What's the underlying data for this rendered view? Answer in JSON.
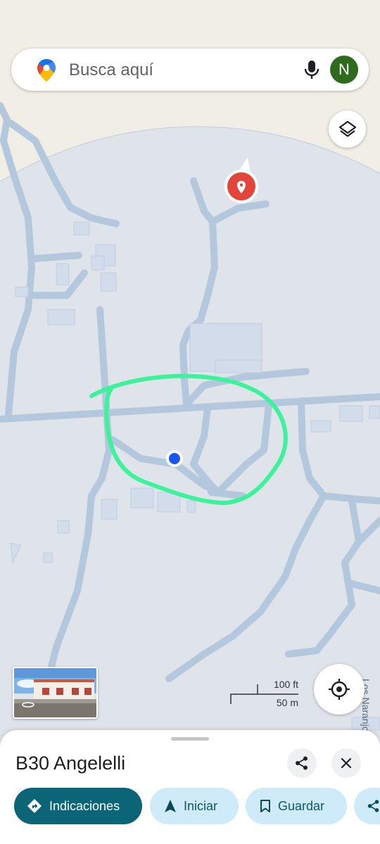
{
  "search": {
    "placeholder": "Busca aquí"
  },
  "account": {
    "initial": "N",
    "color": "#2f6b1f"
  },
  "map": {
    "scale_labels": {
      "feet": "100 ft",
      "meters": "50 m"
    },
    "street_label": "Los Naranjos",
    "colors": {
      "land": "#f1eee6",
      "area": "#dfe3ea",
      "road": "#b3c7dd",
      "annotation": "#3cf29b",
      "user_dot": "#1a56f0",
      "pin": "#e2453a"
    }
  },
  "place": {
    "title": "B30 Angelelli"
  },
  "actions": {
    "directions": "Indicaciones",
    "start": "Iniciar",
    "save": "Guardar"
  },
  "icons": [
    "maps-logo-icon",
    "mic-icon",
    "layers-icon",
    "my-location-icon",
    "share-icon",
    "close-icon",
    "directions-icon",
    "navigation-arrow-icon",
    "bookmark-icon",
    "location-pin-icon"
  ]
}
